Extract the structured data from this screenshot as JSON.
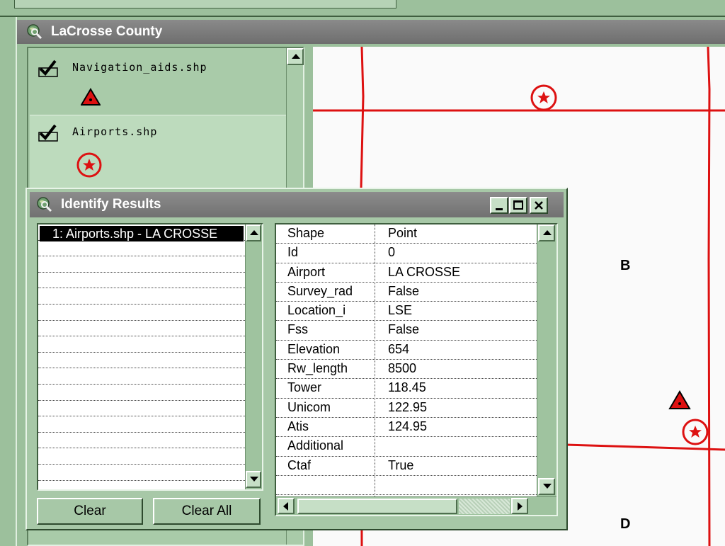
{
  "view": {
    "title": "LaCrosse County",
    "window_icon": "magnifier-globe-icon"
  },
  "toc": {
    "layers": [
      {
        "name": "Navigation_aids.shp",
        "checked": true,
        "symbol": "red-triangle-icon"
      },
      {
        "name": "Airports.shp",
        "checked": true,
        "symbol": "red-circle-star-icon"
      }
    ]
  },
  "map": {
    "labels": [
      "B",
      "D"
    ],
    "line_color": "#dd1111",
    "background": "#fafafa"
  },
  "identify": {
    "title": "Identify Results",
    "results": [
      "1:  Airports.shp - LA CROSSE"
    ],
    "fields": [
      {
        "field": "Shape",
        "value": "Point"
      },
      {
        "field": "Id",
        "value": "0"
      },
      {
        "field": "Airport",
        "value": "LA CROSSE"
      },
      {
        "field": "Survey_rad",
        "value": "False"
      },
      {
        "field": "Location_i",
        "value": "LSE"
      },
      {
        "field": "Fss",
        "value": "False"
      },
      {
        "field": "Elevation",
        "value": "654"
      },
      {
        "field": "Rw_length",
        "value": "8500"
      },
      {
        "field": "Tower",
        "value": "118.45"
      },
      {
        "field": "Unicom",
        "value": "122.95"
      },
      {
        "field": "Atis",
        "value": "124.95"
      },
      {
        "field": "Additional",
        "value": ""
      },
      {
        "field": "Ctaf",
        "value": "True"
      },
      {
        "field": "",
        "value": ""
      }
    ],
    "clear_label": "Clear",
    "clear_all_label": "Clear All"
  },
  "colors": {
    "app_green": "#9cc09c",
    "titlebar_gray": "#7a7a7a",
    "symbol_red": "#dd1111"
  }
}
